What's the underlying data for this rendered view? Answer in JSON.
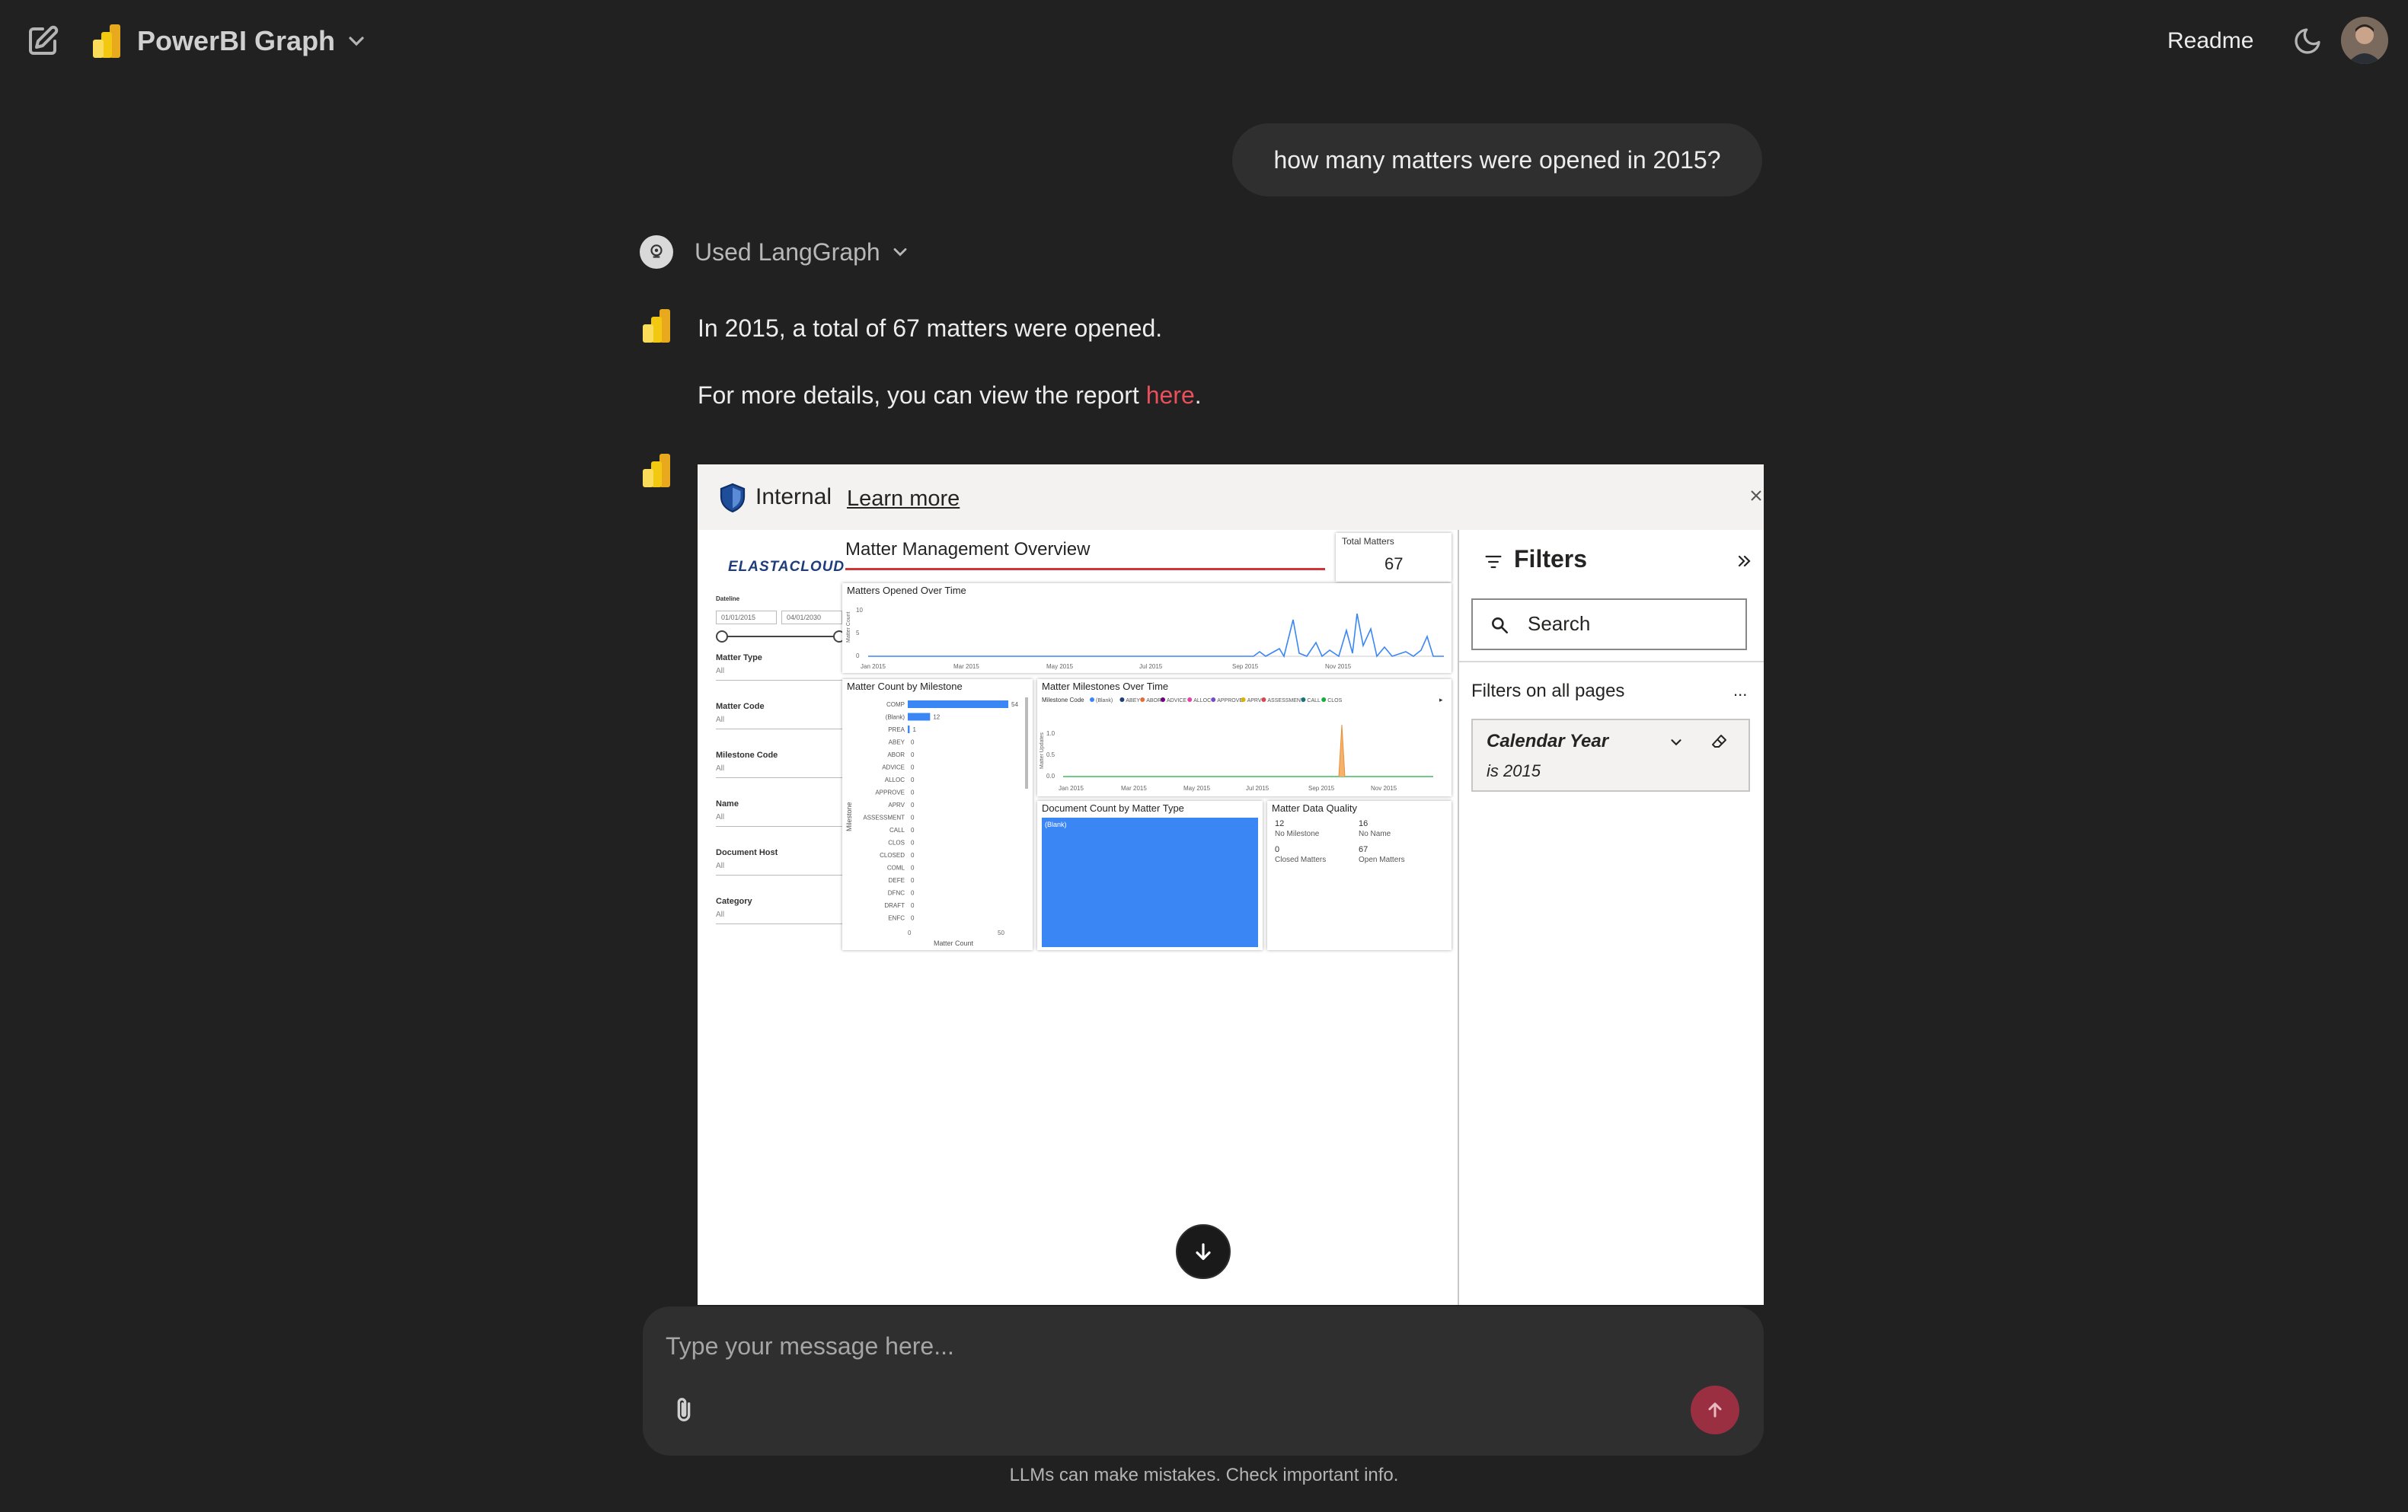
{
  "header": {
    "app_title": "PowerBI Graph",
    "readme_label": "Readme"
  },
  "chat": {
    "user_message": "how many matters were opened in 2015?",
    "tool_label": "Used LangGraph",
    "answer_line1": "In 2015, a total of 67 matters were opened.",
    "answer_line2_prefix": "For more details, you can view the report ",
    "answer_link": "here",
    "answer_line2_suffix": "."
  },
  "embed": {
    "banner_label": "Internal",
    "banner_link": "Learn more",
    "report": {
      "logo": "ELASTACLOUD",
      "title": "Matter Management Overview",
      "kpi_label": "Total Matters",
      "kpi_value": "67",
      "slicers": {
        "date_label": "Dateline",
        "date_from": "01/01/2015",
        "date_to": "04/01/2030",
        "items": [
          {
            "label": "Matter Type",
            "value": "All"
          },
          {
            "label": "Matter Code",
            "value": "All"
          },
          {
            "label": "Milestone Code",
            "value": "All"
          },
          {
            "label": "Name",
            "value": "All"
          },
          {
            "label": "Document Host",
            "value": "All"
          },
          {
            "label": "Category",
            "value": "All"
          }
        ]
      },
      "opened_chart": {
        "title": "Matters Opened Over Time",
        "ylabel": "Matter Count",
        "x_ticks": [
          "Jan 2015",
          "Mar 2015",
          "May 2015",
          "Jul 2015",
          "Sep 2015",
          "Nov 2015"
        ],
        "y_ticks": [
          "0",
          "5",
          "10"
        ]
      },
      "milestone_chart": {
        "title": "Matter Count by Milestone",
        "ylabel": "Milestone",
        "xlabel": "Matter Count",
        "x_ticks": [
          "0",
          "50"
        ],
        "categories": [
          "COMP",
          "(Blank)",
          "PREA",
          "ABEY",
          "ABOR",
          "ADVICE",
          "ALLOC",
          "APPROVE",
          "APRV",
          "ASSESSMENT",
          "CALL",
          "CLOS",
          "CLOSED",
          "COML",
          "DEFE",
          "DFNC",
          "DRAFT",
          "ENFC"
        ],
        "values": [
          54,
          12,
          1,
          0,
          0,
          0,
          0,
          0,
          0,
          0,
          0,
          0,
          0,
          0,
          0,
          0,
          0,
          0
        ],
        "value_labels": [
          "54",
          "12",
          "1",
          "0",
          "0",
          "0",
          "0",
          "0",
          "0",
          "0",
          "0",
          "0",
          "0",
          "0",
          "0",
          "0",
          "0",
          "0"
        ]
      },
      "milestone_time_chart": {
        "title": "Matter Milestones Over Time",
        "legend_title": "Milestone Code",
        "legend": [
          "(Blank)",
          "ABEY",
          "ABOR",
          "ADVICE",
          "ALLOC",
          "APPROVE",
          "APRV",
          "ASSESSMENT",
          "CALL",
          "CLOS"
        ],
        "ylabel": "Matter Updates",
        "y_ticks": [
          "0.0",
          "0.5",
          "1.0"
        ],
        "x_ticks": [
          "Jan 2015",
          "Mar 2015",
          "May 2015",
          "Jul 2015",
          "Sep 2015",
          "Nov 2015"
        ]
      },
      "doc_type_chart": {
        "title": "Document Count by Matter Type",
        "label": "(Blank)"
      },
      "quality_card": {
        "title": "Matter Data Quality",
        "cells": [
          {
            "value": "12",
            "label": "No Milestone"
          },
          {
            "value": "16",
            "label": "No Name"
          },
          {
            "value": "0",
            "label": "Closed Matters"
          },
          {
            "value": "67",
            "label": "Open Matters"
          }
        ]
      }
    },
    "filters": {
      "title": "Filters",
      "search": "Search",
      "section": "Filters on all pages",
      "more": "...",
      "card_title": "Calendar Year",
      "card_value": "is 2015"
    }
  },
  "composer": {
    "placeholder": "Type your message here..."
  },
  "footer": {
    "note": "LLMs can make mistakes. Check important info."
  },
  "colors": {
    "background": "#212121",
    "bubble": "#2f2f2f",
    "link": "#e8505b",
    "send": "#9a2f41",
    "chart_blue": "#3b86f5",
    "title_rule": "#d13438"
  }
}
